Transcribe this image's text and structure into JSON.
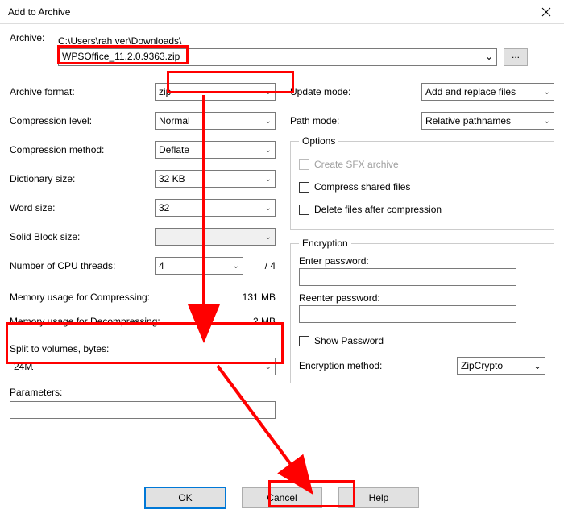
{
  "window": {
    "title": "Add to Archive"
  },
  "archive": {
    "label": "Archive:",
    "path_prefix": "C:\\Users\\rah ver\\Downloads\\",
    "filename": "WPSOffice_11.2.0.9363.zip",
    "browse": "..."
  },
  "left": {
    "format_label": "Archive format:",
    "format_value": "zip",
    "level_label": "Compression level:",
    "level_value": "Normal",
    "method_label": "Compression method:",
    "method_value": "Deflate",
    "dict_label": "Dictionary size:",
    "dict_value": "32 KB",
    "word_label": "Word size:",
    "word_value": "32",
    "block_label": "Solid Block size:",
    "block_value": "",
    "threads_label": "Number of CPU threads:",
    "threads_value": "4",
    "threads_max": "/ 4",
    "mem_comp_label": "Memory usage for Compressing:",
    "mem_comp_value": "131 MB",
    "mem_decomp_label": "Memory usage for Decompressing:",
    "mem_decomp_value": "2 MB",
    "split_label": "Split to volumes, bytes:",
    "split_value": "24M",
    "params_label": "Parameters:",
    "params_value": ""
  },
  "right": {
    "update_label": "Update mode:",
    "update_value": "Add and replace files",
    "pathmode_label": "Path mode:",
    "pathmode_value": "Relative pathnames",
    "options_legend": "Options",
    "opt_sfx": "Create SFX archive",
    "opt_shared": "Compress shared files",
    "opt_delete": "Delete files after compression",
    "enc_legend": "Encryption",
    "enter_pw": "Enter password:",
    "reenter_pw": "Reenter password:",
    "show_pw": "Show Password",
    "enc_method_label": "Encryption method:",
    "enc_method_value": "ZipCrypto"
  },
  "buttons": {
    "ok": "OK",
    "cancel": "Cancel",
    "help": "Help"
  }
}
